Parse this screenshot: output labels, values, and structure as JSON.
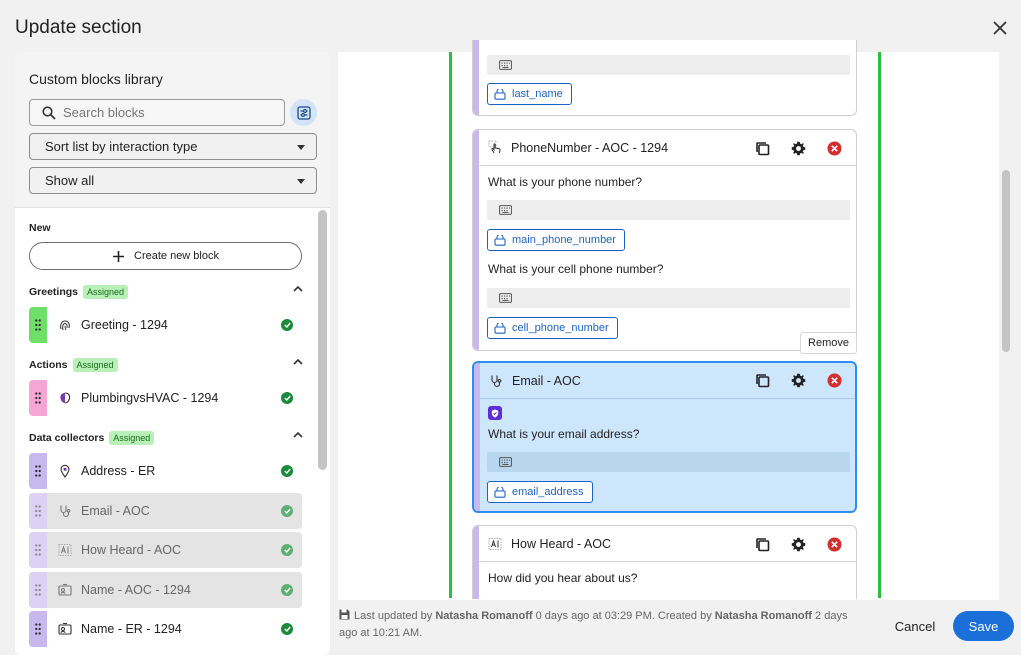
{
  "dialog": {
    "title": "Update section"
  },
  "library": {
    "title": "Custom blocks library",
    "search_placeholder": "Search blocks",
    "sort_value": "Sort list by interaction type",
    "show_value": "Show all",
    "new_label": "New",
    "create_label": "Create new block",
    "greetings": {
      "label": "Greetings",
      "badge": "Assigned",
      "items": [
        {
          "name": "Greeting - 1294",
          "icon": "fingerprint-icon",
          "color": "#6ee06a"
        }
      ]
    },
    "actions": {
      "label": "Actions",
      "badge": "Assigned",
      "items": [
        {
          "name": "PlumbingvsHVAC - 1294",
          "icon": "brain-icon",
          "color": "#f6a6d4"
        }
      ]
    },
    "data_collectors": {
      "label": "Data collectors",
      "badge": "Assigned",
      "items": [
        {
          "name": "Address - ER",
          "icon": "location-pin-icon",
          "color": "#c8b8ee"
        },
        {
          "name": "Email - AOC",
          "icon": "stethoscope-icon",
          "color": "#c8b8ee"
        },
        {
          "name": "How Heard - AOC",
          "icon": "text-cursor-icon",
          "color": "#c8b8ee"
        },
        {
          "name": "Name - AOC - 1294",
          "icon": "id-card-icon",
          "color": "#c8b8ee"
        },
        {
          "name": "Name - ER - 1294",
          "icon": "id-card-icon",
          "color": "#c8b8ee"
        }
      ]
    }
  },
  "canvas": {
    "card0": {
      "variable": "last_name"
    },
    "card1": {
      "title": "PhoneNumber - AOC - 1294",
      "q1": "What is your phone number?",
      "v1": "main_phone_number",
      "q2": "What is your cell phone number?",
      "v2": "cell_phone_number"
    },
    "card2": {
      "title": "Email - AOC",
      "q1": "What is your email address?",
      "v1": "email_address"
    },
    "card3": {
      "title": "How Heard - AOC",
      "q1": "How did you hear about us?"
    },
    "tooltip": "Remove"
  },
  "footer": {
    "prefix": "Last updated by",
    "updated_by": "Natasha Romanoff",
    "updated_time": "0 days ago at 03:29 PM. Created by",
    "created_by": "Natasha Romanoff",
    "created_time": "2 days ago at 10:21 AM.",
    "cancel_label": "Cancel",
    "save_label": "Save"
  },
  "colors": {
    "accent": "#1a6fd8",
    "selected_bg": "#cde6fb",
    "green_rail": "#2bbf3a",
    "remove_red": "#d32f2f"
  }
}
